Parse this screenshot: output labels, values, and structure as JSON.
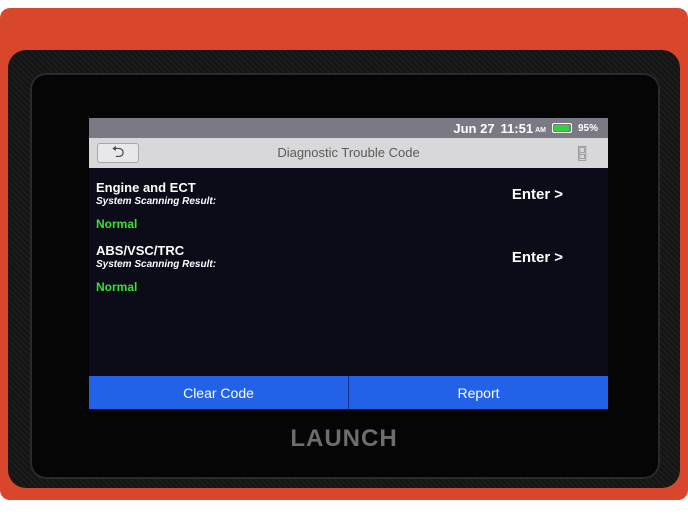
{
  "device": {
    "brand": "LAUNCH"
  },
  "statusbar": {
    "date": "Jun 27",
    "time": "11:51",
    "ampm": "AM",
    "battery_percent": "95%",
    "battery_level": 0.95,
    "battery_color": "#34d13a"
  },
  "header": {
    "title": "Diagnostic Trouble Code",
    "back_icon": "back-arrow-icon",
    "exit_icon": "exit-icon"
  },
  "systems": [
    {
      "name": "Engine and ECT",
      "subtitle": "System Scanning Result:",
      "status": "Normal",
      "action": "Enter",
      "action_glyph": ">"
    },
    {
      "name": "ABS/VSC/TRC",
      "subtitle": "System Scanning Result:",
      "status": "Normal",
      "action": "Enter",
      "action_glyph": ">"
    }
  ],
  "footer": {
    "clear_label": "Clear Code",
    "report_label": "Report"
  },
  "colors": {
    "accent_blue": "#2262e8",
    "status_normal": "#38e030",
    "housing": "#d8462c"
  }
}
